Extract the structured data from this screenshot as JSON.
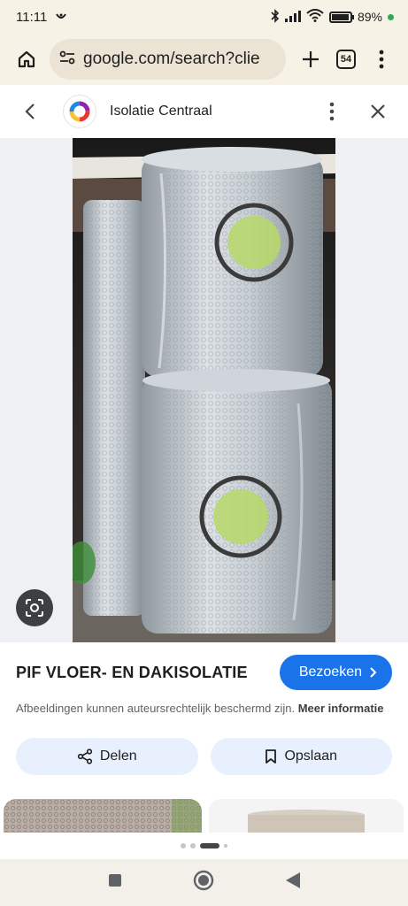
{
  "status": {
    "time": "11:11",
    "battery_percent": "89%"
  },
  "browser": {
    "url": "google.com/search?clie",
    "tab_count": "54"
  },
  "viewer": {
    "site_name": "Isolatie Centraal"
  },
  "result": {
    "title": "PIF VLOER- EN DAKISOLATIE",
    "visit_label": "Bezoeken",
    "notice": "Afbeeldingen kunnen auteursrechtelijk beschermd zijn.",
    "notice_link": "Meer informatie",
    "share_label": "Delen",
    "save_label": "Opslaan"
  },
  "colors": {
    "accent": "#1a73e8",
    "tonal_button": "#e8f0fe",
    "browser_chrome": "#f7f2e6"
  },
  "icons": [
    "home-icon",
    "site-settings-icon",
    "new-tab-icon",
    "tab-switcher-icon",
    "menu-icon",
    "back-icon",
    "more-vert-icon",
    "close-icon",
    "lens-icon",
    "share-icon",
    "bookmark-icon",
    "chevron-right-icon",
    "nav-recents-icon",
    "nav-home-icon",
    "nav-back-icon"
  ]
}
